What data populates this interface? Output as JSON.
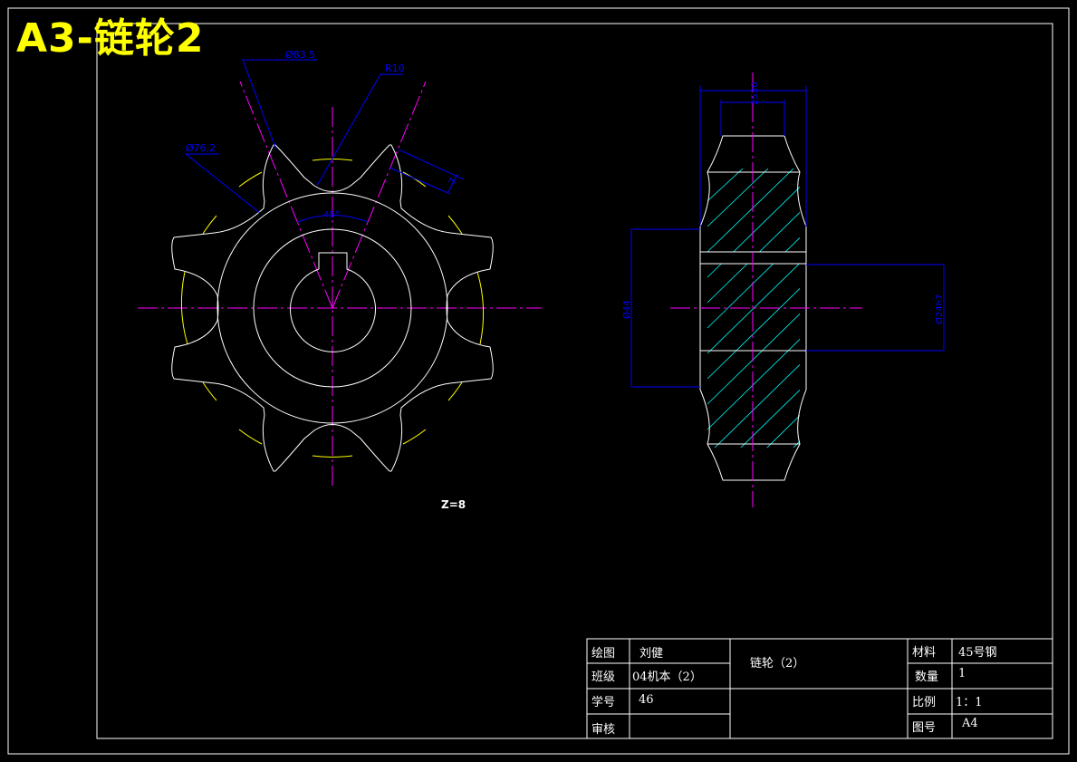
{
  "banner": {
    "title": "A3-链轮2"
  },
  "front_view": {
    "dim_tip_dia": "Ø83.5",
    "dim_radius": "R10",
    "dim_root_dia": "Ø76.2",
    "dim_angle": "45°",
    "dim_width": "7",
    "teeth_label": "Z=8"
  },
  "side_view": {
    "dim_total_width": "30",
    "dim_tooth_width": "25",
    "dim_hub_dia": "Ø44",
    "dim_bore_dia": "Ø24h7"
  },
  "title_block": {
    "drawn_by_label": "绘图",
    "drawn_by_value": "刘健",
    "drawing_name": "链轮（2）",
    "material_label": "材料",
    "material_value": "45号钢",
    "class_label": "班级",
    "class_value": "04机本（2）",
    "quantity_label": "数量",
    "quantity_value": "1",
    "student_no_label": "学号",
    "student_no_value": "46",
    "scale_label": "比例",
    "scale_value": "1：1",
    "review_label": "审核",
    "sheet_label": "图号",
    "sheet_value": "A4"
  },
  "colors": {
    "outline": "#ffffff",
    "dimension": "#0000ff",
    "centerline": "#ff00ff",
    "hatch": "#00ffff",
    "pitch_circle": "#ffff00"
  }
}
